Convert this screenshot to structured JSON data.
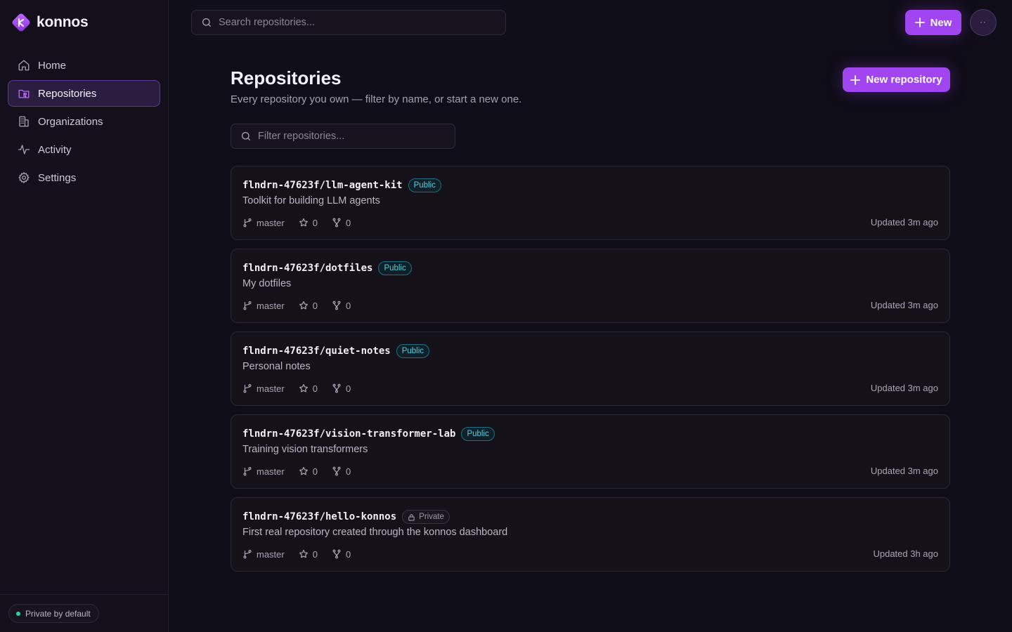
{
  "app": {
    "name": "konnos",
    "accent": "#a045f0",
    "logo_icon": "konnos-diamond-logo"
  },
  "sidebar": {
    "items": [
      {
        "label": "Home",
        "icon": "home-icon"
      },
      {
        "label": "Repositories",
        "icon": "repo-icon",
        "active": true
      },
      {
        "label": "Organizations",
        "icon": "building-icon"
      },
      {
        "label": "Activity",
        "icon": "activity-icon"
      },
      {
        "label": "Settings",
        "icon": "gear-icon"
      }
    ],
    "footer_badge": "Private by default"
  },
  "header": {
    "search_placeholder": "Search repositories...",
    "new_label": "New",
    "avatar_text": "··"
  },
  "main": {
    "title": "Repositories",
    "subtitle": "Every repository you own — filter by name, or start a new one.",
    "new_repo_label": "New repository",
    "filter_placeholder": "Filter repositories..."
  },
  "repos": [
    {
      "name": "flndrn-47623f/llm-agent-kit",
      "visibility": "Public",
      "description": "Toolkit for building LLM agents",
      "branch": "master",
      "stars": "0",
      "forks": "0",
      "updated": "Updated 3m ago"
    },
    {
      "name": "flndrn-47623f/dotfiles",
      "visibility": "Public",
      "description": "My dotfiles",
      "branch": "master",
      "stars": "0",
      "forks": "0",
      "updated": "Updated 3m ago"
    },
    {
      "name": "flndrn-47623f/quiet-notes",
      "visibility": "Public",
      "description": "Personal notes",
      "branch": "master",
      "stars": "0",
      "forks": "0",
      "updated": "Updated 3m ago"
    },
    {
      "name": "flndrn-47623f/vision-transformer-lab",
      "visibility": "Public",
      "description": "Training vision transformers",
      "branch": "master",
      "stars": "0",
      "forks": "0",
      "updated": "Updated 3m ago"
    },
    {
      "name": "flndrn-47623f/hello-konnos",
      "visibility": "Private",
      "description": "First real repository created through the konnos dashboard",
      "branch": "master",
      "stars": "0",
      "forks": "0",
      "updated": "Updated 3h ago"
    }
  ]
}
